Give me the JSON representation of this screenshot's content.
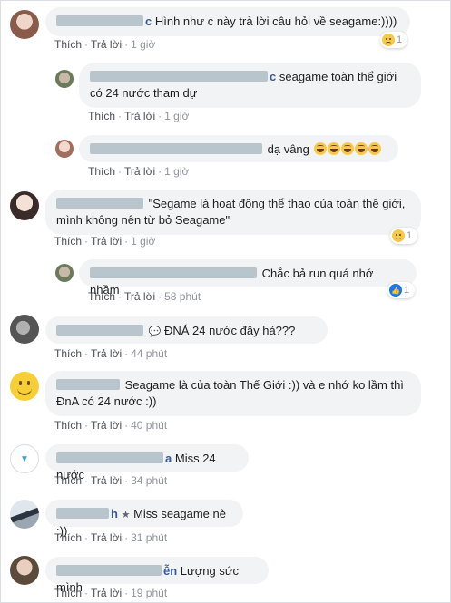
{
  "labels": {
    "like": "Thích",
    "reply": "Trả lời",
    "dot": "·"
  },
  "comments": [
    {
      "name_tail": "c",
      "text": "Hình như c này trả lời câu hỏi về seagame:))))",
      "time": "1 giờ",
      "reaction_count": "1"
    },
    {
      "name_tail": "c",
      "text": "seagame toàn thể giới có 24 nước tham dự",
      "time": "1 giờ"
    },
    {
      "name_tail": "",
      "text": "dạ vâng",
      "time": "1 giờ"
    },
    {
      "name_tail": "",
      "text": "\"Segame là hoạt động thể thao của toàn thế giới, mình không nên từ bỏ Seagame\"",
      "time": "1 giờ",
      "reaction_count": "1"
    },
    {
      "name_tail": "",
      "text": "Chắc bả run quá nhớ nhầm",
      "time": "58 phút",
      "reaction_count": "1"
    },
    {
      "name_tail": "",
      "text": "ĐNÁ 24 nước đây hả???",
      "time": "44 phút"
    },
    {
      "name_tail": "",
      "text": "Seagame là của toàn Thế Giới :)) và e nhớ ko lầm thì ĐnA có 24 nước :))",
      "time": "40 phút"
    },
    {
      "name_tail": "a",
      "text": "Miss 24 nước",
      "time": "34 phút"
    },
    {
      "name_tail": "h",
      "text": "Miss seagame nè :))",
      "time": "31 phút"
    },
    {
      "name_tail": "ễn",
      "text": "Lượng sức mình",
      "time": "19 phút"
    }
  ]
}
